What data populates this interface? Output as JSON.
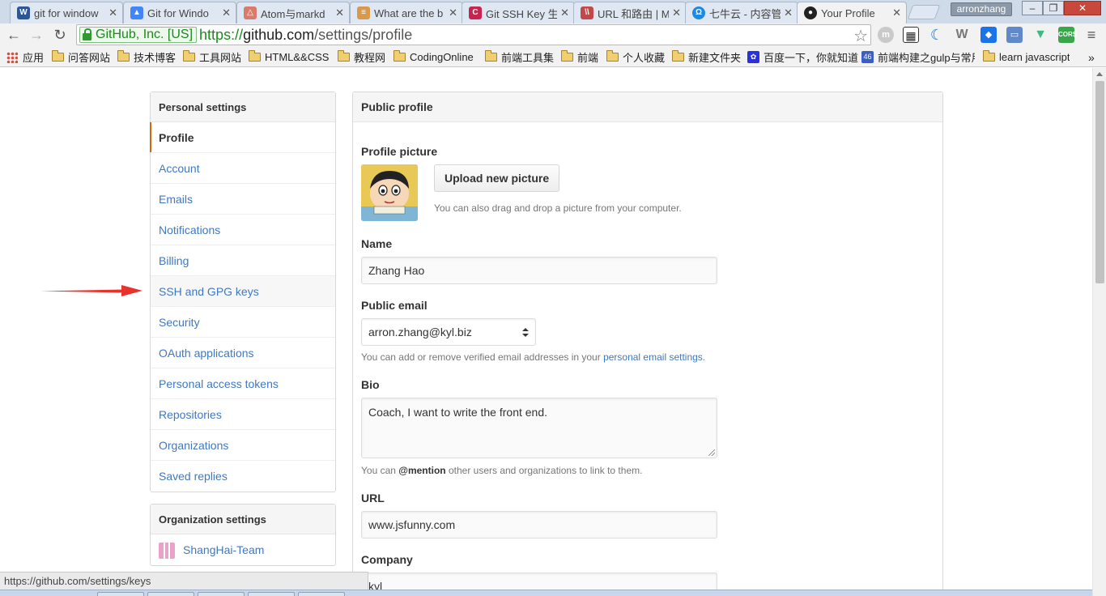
{
  "browser": {
    "tabs": [
      {
        "title": "git for window",
        "favicon": "word-doc-icon",
        "color": "#2b579a"
      },
      {
        "title": "Git for Windo",
        "favicon": "google-drive-icon",
        "color": "#4285f4"
      },
      {
        "title": "Atom与markd",
        "favicon": "csdn-icon",
        "color": "#d87b6a"
      },
      {
        "title": "What are the b",
        "favicon": "stack-icon",
        "color": "#d89a4a"
      },
      {
        "title": "Git SSH Key 生",
        "favicon": "c-icon",
        "color": "#c7254e"
      },
      {
        "title": "URL 和路由 | M",
        "favicon": "meteor-icon",
        "color": "#c04a4a"
      },
      {
        "title": "七牛云 - 内容管",
        "favicon": "qiniu-icon",
        "color": "#1e88e5"
      },
      {
        "title": "Your Profile",
        "favicon": "github-icon",
        "color": "#222222",
        "active": true
      }
    ],
    "user_name": "arronzhang",
    "window_buttons": {
      "minimize": "–",
      "restore": "❐",
      "close": "✕"
    },
    "address": {
      "ev_label": "GitHub, Inc. [US]",
      "scheme": "https://",
      "host": "github.com",
      "path": "/settings/profile"
    },
    "extensions": [
      "m-icon",
      "qr-icon",
      "moon-icon",
      "w-icon",
      "dropbox-icon",
      "cast-icon",
      "vue-icon",
      "cors-icon",
      "menu-icon"
    ],
    "bookmarks": [
      {
        "label": "应用",
        "icon": "apps-icon"
      },
      {
        "label": "问答网站",
        "icon": "folder-icon"
      },
      {
        "label": "技术博客",
        "icon": "folder-icon"
      },
      {
        "label": "工具网站",
        "icon": "folder-icon"
      },
      {
        "label": "HTML&&CSS",
        "icon": "folder-icon"
      },
      {
        "label": "教程网",
        "icon": "folder-icon"
      },
      {
        "label": "CodingOnline",
        "icon": "folder-icon"
      },
      {
        "label": "前端工具集",
        "icon": "folder-icon"
      },
      {
        "label": "前端",
        "icon": "folder-icon"
      },
      {
        "label": "个人收藏",
        "icon": "folder-icon"
      },
      {
        "label": "新建文件夹",
        "icon": "folder-icon"
      },
      {
        "label": "百度一下，你就知道",
        "icon": "baidu-icon"
      },
      {
        "label": "前端构建之gulp与常用",
        "icon": "segmentfault-icon"
      },
      {
        "label": "learn javascript",
        "icon": "folder-icon"
      }
    ],
    "more_bookmarks": "»",
    "status_url": "https://github.com/settings/keys"
  },
  "settings_menu": {
    "heading": "Personal settings",
    "items": [
      {
        "label": "Profile",
        "selected": true
      },
      {
        "label": "Account"
      },
      {
        "label": "Emails"
      },
      {
        "label": "Notifications"
      },
      {
        "label": "Billing"
      },
      {
        "label": "SSH and GPG keys",
        "hover": true
      },
      {
        "label": "Security"
      },
      {
        "label": "OAuth applications"
      },
      {
        "label": "Personal access tokens"
      },
      {
        "label": "Repositories"
      },
      {
        "label": "Organizations"
      },
      {
        "label": "Saved replies"
      }
    ]
  },
  "org_menu": {
    "heading": "Organization settings",
    "items": [
      {
        "label": "ShangHai-Team"
      }
    ]
  },
  "profile": {
    "heading": "Public profile",
    "picture_label": "Profile picture",
    "upload_button": "Upload new picture",
    "upload_hint": "You can also drag and drop a picture from your computer.",
    "name_label": "Name",
    "name_value": "Zhang Hao",
    "email_label": "Public email",
    "email_value": "arron.zhang@kyl.biz",
    "email_note_prefix": "You can add or remove verified email addresses in your ",
    "email_note_link": "personal email settings",
    "email_note_suffix": ".",
    "bio_label": "Bio",
    "bio_value": "Coach, I want to write the front end.",
    "bio_note_prefix": "You can ",
    "bio_note_mention": "@mention",
    "bio_note_suffix": " other users and organizations to link to them.",
    "url_label": "URL",
    "url_value": "www.jsfunny.com",
    "company_label": "Company",
    "company_value": "kyl"
  },
  "annotation": {
    "arrow_color": "#e8322b"
  },
  "colors": {
    "link": "#4078c0",
    "selected_accent": "#d26911",
    "ev_green": "#1c8a1c"
  }
}
